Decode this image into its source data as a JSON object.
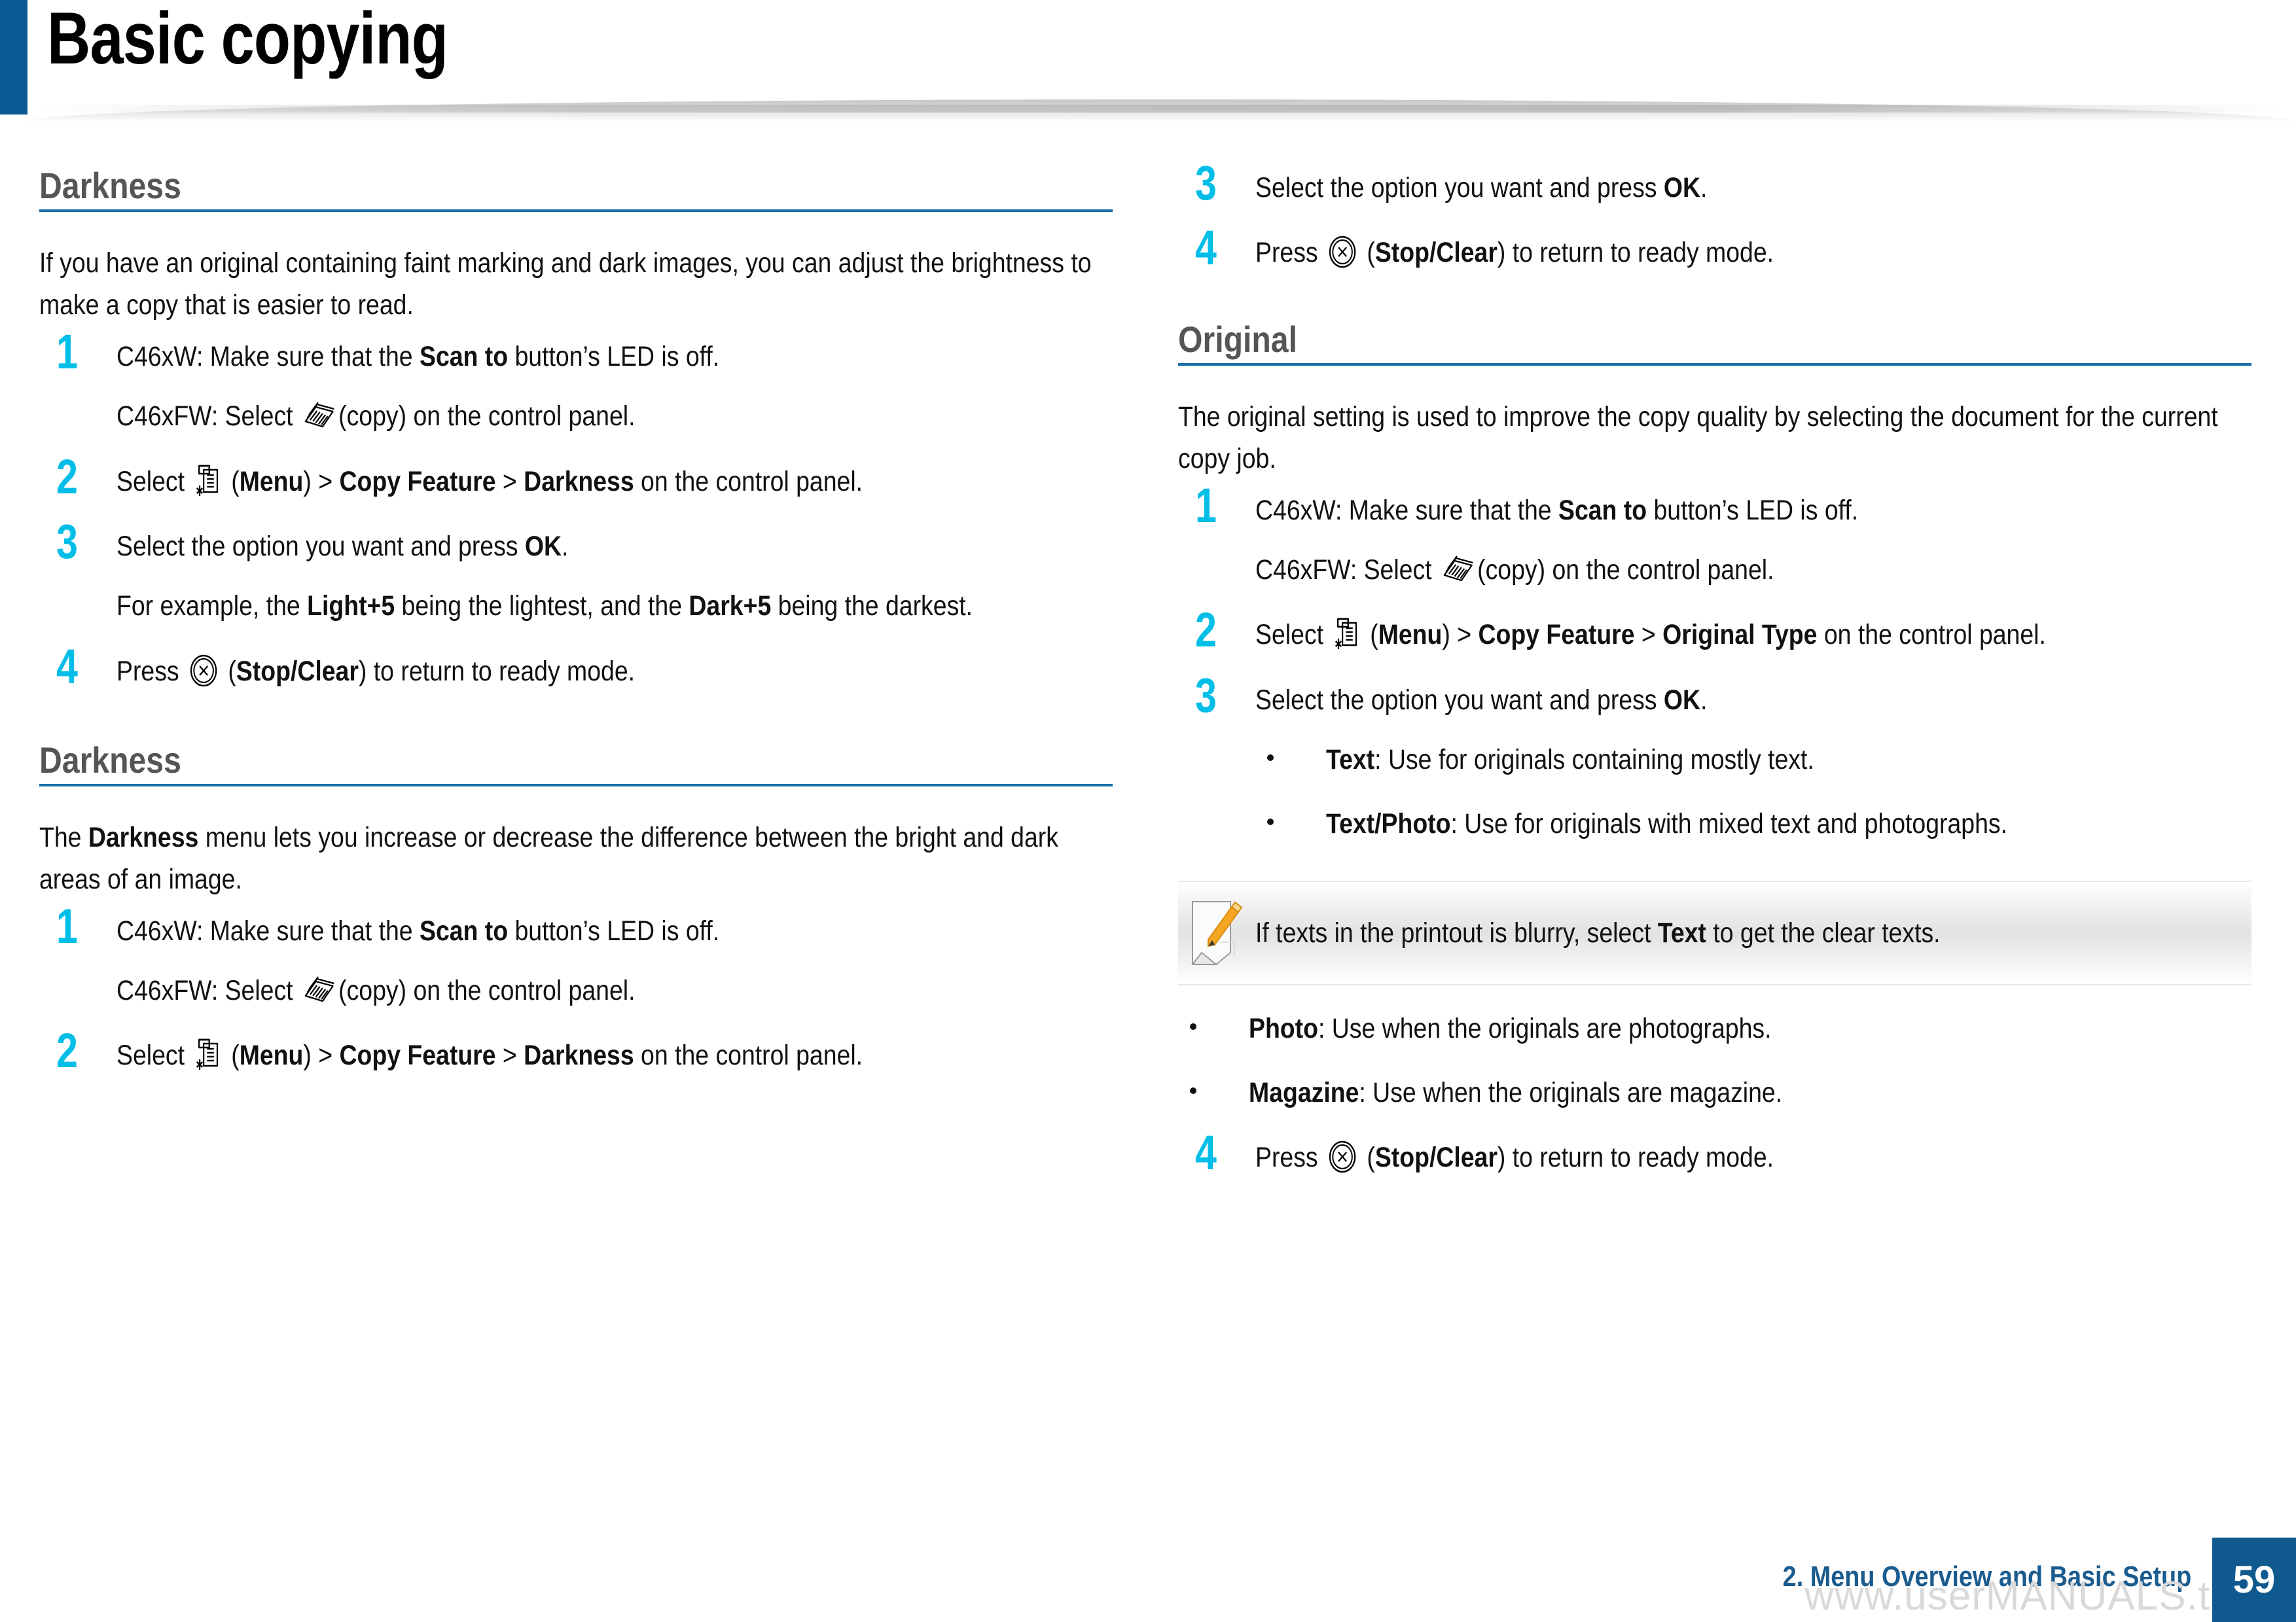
{
  "header": {
    "title": "Basic copying",
    "accent_color": "#0a5b93"
  },
  "colors": {
    "accent_blue": "#0a5b93",
    "rule_blue": "#1b6fa8",
    "step_number_cyan": "#00BEE8",
    "heading_gray": "#555555",
    "footer_blue": "#1b5c8f",
    "page_box_blue": "#10598f"
  },
  "left_column": {
    "section1": {
      "heading": "Darkness",
      "intro": "If you have an original containing faint marking and dark images, you can adjust the brightness to make a copy that is easier to read.",
      "steps": [
        {
          "number": "1",
          "lines": [
            {
              "parts": [
                {
                  "t": "C46xW: Make sure that the "
                },
                {
                  "t": "Scan to",
                  "b": true
                },
                {
                  "t": " button’s LED is off."
                }
              ]
            },
            {
              "parts": [
                {
                  "t": "C46xFW: Select "
                },
                {
                  "icon": "copy-icon"
                },
                {
                  "t": "(copy) on the control panel."
                }
              ]
            }
          ]
        },
        {
          "number": "2",
          "lines": [
            {
              "parts": [
                {
                  "t": "Select "
                },
                {
                  "icon": "menu-icon"
                },
                {
                  "t": " ("
                },
                {
                  "t": "Menu",
                  "b": true
                },
                {
                  "t": ") > "
                },
                {
                  "t": "Copy Feature",
                  "b": true
                },
                {
                  "t": " > "
                },
                {
                  "t": "Darkness",
                  "b": true
                },
                {
                  "t": " on the control panel."
                }
              ]
            }
          ]
        },
        {
          "number": "3",
          "lines": [
            {
              "parts": [
                {
                  "t": "Select the option you want and press "
                },
                {
                  "t": "OK",
                  "b": true
                },
                {
                  "t": "."
                }
              ]
            },
            {
              "parts": [
                {
                  "t": "For example, the "
                },
                {
                  "t": "Light+5",
                  "b": true
                },
                {
                  "t": " being the lightest, and the "
                },
                {
                  "t": "Dark+5",
                  "b": true
                },
                {
                  "t": " being the darkest."
                }
              ]
            }
          ]
        },
        {
          "number": "4",
          "lines": [
            {
              "parts": [
                {
                  "t": "Press "
                },
                {
                  "icon": "stop-clear-icon"
                },
                {
                  "t": " ("
                },
                {
                  "t": "Stop/Clear",
                  "b": true
                },
                {
                  "t": ") to return to ready mode."
                }
              ]
            }
          ]
        }
      ]
    },
    "section2": {
      "heading": "Darkness",
      "intro_parts": [
        {
          "t": "The "
        },
        {
          "t": "Darkness",
          "b": true
        },
        {
          "t": " menu lets you increase or decrease the difference between the bright and dark areas of an image."
        }
      ],
      "steps": [
        {
          "number": "1",
          "lines": [
            {
              "parts": [
                {
                  "t": "C46xW: Make sure that the "
                },
                {
                  "t": "Scan to",
                  "b": true
                },
                {
                  "t": " button’s LED is off."
                }
              ]
            },
            {
              "parts": [
                {
                  "t": "C46xFW: Select "
                },
                {
                  "icon": "copy-icon"
                },
                {
                  "t": "(copy) on the control panel."
                }
              ]
            }
          ]
        },
        {
          "number": "2",
          "lines": [
            {
              "parts": [
                {
                  "t": "Select "
                },
                {
                  "icon": "menu-icon"
                },
                {
                  "t": " ("
                },
                {
                  "t": "Menu",
                  "b": true
                },
                {
                  "t": ") > "
                },
                {
                  "t": "Copy Feature",
                  "b": true
                },
                {
                  "t": " > "
                },
                {
                  "t": "Darkness",
                  "b": true
                },
                {
                  "t": " on the control panel."
                }
              ]
            }
          ]
        }
      ]
    }
  },
  "right_column": {
    "continued_steps": [
      {
        "number": "3",
        "lines": [
          {
            "parts": [
              {
                "t": "Select the option you want and press "
              },
              {
                "t": "OK",
                "b": true
              },
              {
                "t": "."
              }
            ]
          }
        ]
      },
      {
        "number": "4",
        "lines": [
          {
            "parts": [
              {
                "t": "Press "
              },
              {
                "icon": "stop-clear-icon"
              },
              {
                "t": " ("
              },
              {
                "t": "Stop/Clear",
                "b": true
              },
              {
                "t": ") to return to ready mode."
              }
            ]
          }
        ]
      }
    ],
    "section": {
      "heading": "Original",
      "intro": "The original setting is used to improve the copy quality by selecting the document for the current copy job.",
      "steps": [
        {
          "number": "1",
          "lines": [
            {
              "parts": [
                {
                  "t": "C46xW: Make sure that the "
                },
                {
                  "t": "Scan to",
                  "b": true
                },
                {
                  "t": " button’s LED is off."
                }
              ]
            },
            {
              "parts": [
                {
                  "t": "C46xFW: Select "
                },
                {
                  "icon": "copy-icon"
                },
                {
                  "t": "(copy) on the control panel."
                }
              ]
            }
          ]
        },
        {
          "number": "2",
          "lines": [
            {
              "parts": [
                {
                  "t": "Select "
                },
                {
                  "icon": "menu-icon"
                },
                {
                  "t": " ("
                },
                {
                  "t": "Menu",
                  "b": true
                },
                {
                  "t": ") > "
                },
                {
                  "t": "Copy Feature",
                  "b": true
                },
                {
                  "t": " > "
                },
                {
                  "t": "Original Type",
                  "b": true
                },
                {
                  "t": " on the control panel."
                }
              ]
            }
          ]
        },
        {
          "number": "3",
          "lines": [
            {
              "parts": [
                {
                  "t": "Select the option you want and press "
                },
                {
                  "t": "OK",
                  "b": true
                },
                {
                  "t": "."
                }
              ]
            }
          ],
          "bullets": [
            {
              "parts": [
                {
                  "t": "Text",
                  "b": true
                },
                {
                  "t": ": Use for originals containing mostly text."
                }
              ]
            },
            {
              "parts": [
                {
                  "t": "Text/Photo",
                  "b": true
                },
                {
                  "t": ": Use for originals with mixed text and photographs."
                }
              ]
            }
          ]
        }
      ],
      "note": {
        "icon": "note-pencil-icon",
        "parts": [
          {
            "t": "If texts in the printout is blurry, select "
          },
          {
            "t": "Text",
            "b": true
          },
          {
            "t": " to get the clear texts."
          }
        ]
      },
      "bullets_after_note": [
        {
          "parts": [
            {
              "t": "Photo",
              "b": true
            },
            {
              "t": ": Use when the originals are photographs."
            }
          ]
        },
        {
          "parts": [
            {
              "t": "Magazine",
              "b": true
            },
            {
              "t": ": Use when the originals are magazine."
            }
          ]
        }
      ],
      "final_step": {
        "number": "4",
        "lines": [
          {
            "parts": [
              {
                "t": "Press "
              },
              {
                "icon": "stop-clear-icon"
              },
              {
                "t": " ("
              },
              {
                "t": "Stop/Clear",
                "b": true
              },
              {
                "t": ") to return to ready mode."
              }
            ]
          }
        ]
      }
    }
  },
  "footer": {
    "chapter_label": "2. Menu Overview and Basic Setup",
    "page_number": "59",
    "watermark": "www.userMANUALS.tech"
  }
}
